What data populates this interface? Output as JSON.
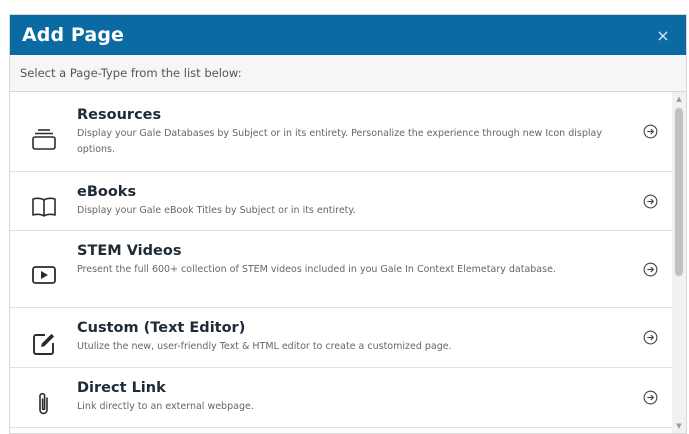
{
  "dialog": {
    "title": "Add Page",
    "close_glyph": "×",
    "subtitle": "Select a Page-Type from the list below:"
  },
  "items": [
    {
      "title": "Resources",
      "description": "Display your Gale Databases by Subject or in its entirety. Personalize the experience through new Icon display options.",
      "icon": "tray-stack-icon"
    },
    {
      "title": "eBooks",
      "description": "Display your Gale eBook Titles by Subject or in its entirety.",
      "icon": "open-book-icon"
    },
    {
      "title": "STEM Videos",
      "description": "Present the full 600+ collection of STEM videos included in you Gale In Context Elemetary database.",
      "icon": "video-play-icon"
    },
    {
      "title": "Custom (Text Editor)",
      "description": "Utulize the new, user-friendly Text & HTML editor to create a customized page.",
      "icon": "edit-pencil-icon"
    },
    {
      "title": "Direct Link",
      "description": "Link directly to an external webpage.",
      "icon": "paperclip-icon"
    }
  ],
  "colors": {
    "header_bg": "#0b6aa2",
    "subbar_bg": "#f6f6f6",
    "title_text": "#1e2a36",
    "desc_text": "#666666"
  }
}
